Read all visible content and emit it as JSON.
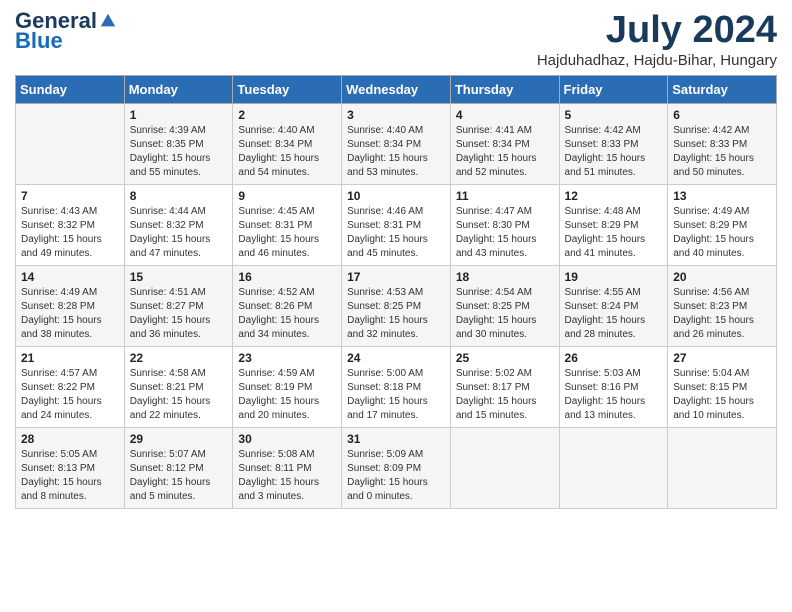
{
  "header": {
    "logo_general": "General",
    "logo_blue": "Blue",
    "month_title": "July 2024",
    "location": "Hajduhadhaz, Hajdu-Bihar, Hungary"
  },
  "days_of_week": [
    "Sunday",
    "Monday",
    "Tuesday",
    "Wednesday",
    "Thursday",
    "Friday",
    "Saturday"
  ],
  "weeks": [
    [
      {
        "day": "",
        "info": ""
      },
      {
        "day": "1",
        "info": "Sunrise: 4:39 AM\nSunset: 8:35 PM\nDaylight: 15 hours\nand 55 minutes."
      },
      {
        "day": "2",
        "info": "Sunrise: 4:40 AM\nSunset: 8:34 PM\nDaylight: 15 hours\nand 54 minutes."
      },
      {
        "day": "3",
        "info": "Sunrise: 4:40 AM\nSunset: 8:34 PM\nDaylight: 15 hours\nand 53 minutes."
      },
      {
        "day": "4",
        "info": "Sunrise: 4:41 AM\nSunset: 8:34 PM\nDaylight: 15 hours\nand 52 minutes."
      },
      {
        "day": "5",
        "info": "Sunrise: 4:42 AM\nSunset: 8:33 PM\nDaylight: 15 hours\nand 51 minutes."
      },
      {
        "day": "6",
        "info": "Sunrise: 4:42 AM\nSunset: 8:33 PM\nDaylight: 15 hours\nand 50 minutes."
      }
    ],
    [
      {
        "day": "7",
        "info": "Sunrise: 4:43 AM\nSunset: 8:32 PM\nDaylight: 15 hours\nand 49 minutes."
      },
      {
        "day": "8",
        "info": "Sunrise: 4:44 AM\nSunset: 8:32 PM\nDaylight: 15 hours\nand 47 minutes."
      },
      {
        "day": "9",
        "info": "Sunrise: 4:45 AM\nSunset: 8:31 PM\nDaylight: 15 hours\nand 46 minutes."
      },
      {
        "day": "10",
        "info": "Sunrise: 4:46 AM\nSunset: 8:31 PM\nDaylight: 15 hours\nand 45 minutes."
      },
      {
        "day": "11",
        "info": "Sunrise: 4:47 AM\nSunset: 8:30 PM\nDaylight: 15 hours\nand 43 minutes."
      },
      {
        "day": "12",
        "info": "Sunrise: 4:48 AM\nSunset: 8:29 PM\nDaylight: 15 hours\nand 41 minutes."
      },
      {
        "day": "13",
        "info": "Sunrise: 4:49 AM\nSunset: 8:29 PM\nDaylight: 15 hours\nand 40 minutes."
      }
    ],
    [
      {
        "day": "14",
        "info": "Sunrise: 4:49 AM\nSunset: 8:28 PM\nDaylight: 15 hours\nand 38 minutes."
      },
      {
        "day": "15",
        "info": "Sunrise: 4:51 AM\nSunset: 8:27 PM\nDaylight: 15 hours\nand 36 minutes."
      },
      {
        "day": "16",
        "info": "Sunrise: 4:52 AM\nSunset: 8:26 PM\nDaylight: 15 hours\nand 34 minutes."
      },
      {
        "day": "17",
        "info": "Sunrise: 4:53 AM\nSunset: 8:25 PM\nDaylight: 15 hours\nand 32 minutes."
      },
      {
        "day": "18",
        "info": "Sunrise: 4:54 AM\nSunset: 8:25 PM\nDaylight: 15 hours\nand 30 minutes."
      },
      {
        "day": "19",
        "info": "Sunrise: 4:55 AM\nSunset: 8:24 PM\nDaylight: 15 hours\nand 28 minutes."
      },
      {
        "day": "20",
        "info": "Sunrise: 4:56 AM\nSunset: 8:23 PM\nDaylight: 15 hours\nand 26 minutes."
      }
    ],
    [
      {
        "day": "21",
        "info": "Sunrise: 4:57 AM\nSunset: 8:22 PM\nDaylight: 15 hours\nand 24 minutes."
      },
      {
        "day": "22",
        "info": "Sunrise: 4:58 AM\nSunset: 8:21 PM\nDaylight: 15 hours\nand 22 minutes."
      },
      {
        "day": "23",
        "info": "Sunrise: 4:59 AM\nSunset: 8:19 PM\nDaylight: 15 hours\nand 20 minutes."
      },
      {
        "day": "24",
        "info": "Sunrise: 5:00 AM\nSunset: 8:18 PM\nDaylight: 15 hours\nand 17 minutes."
      },
      {
        "day": "25",
        "info": "Sunrise: 5:02 AM\nSunset: 8:17 PM\nDaylight: 15 hours\nand 15 minutes."
      },
      {
        "day": "26",
        "info": "Sunrise: 5:03 AM\nSunset: 8:16 PM\nDaylight: 15 hours\nand 13 minutes."
      },
      {
        "day": "27",
        "info": "Sunrise: 5:04 AM\nSunset: 8:15 PM\nDaylight: 15 hours\nand 10 minutes."
      }
    ],
    [
      {
        "day": "28",
        "info": "Sunrise: 5:05 AM\nSunset: 8:13 PM\nDaylight: 15 hours\nand 8 minutes."
      },
      {
        "day": "29",
        "info": "Sunrise: 5:07 AM\nSunset: 8:12 PM\nDaylight: 15 hours\nand 5 minutes."
      },
      {
        "day": "30",
        "info": "Sunrise: 5:08 AM\nSunset: 8:11 PM\nDaylight: 15 hours\nand 3 minutes."
      },
      {
        "day": "31",
        "info": "Sunrise: 5:09 AM\nSunset: 8:09 PM\nDaylight: 15 hours\nand 0 minutes."
      },
      {
        "day": "",
        "info": ""
      },
      {
        "day": "",
        "info": ""
      },
      {
        "day": "",
        "info": ""
      }
    ]
  ]
}
